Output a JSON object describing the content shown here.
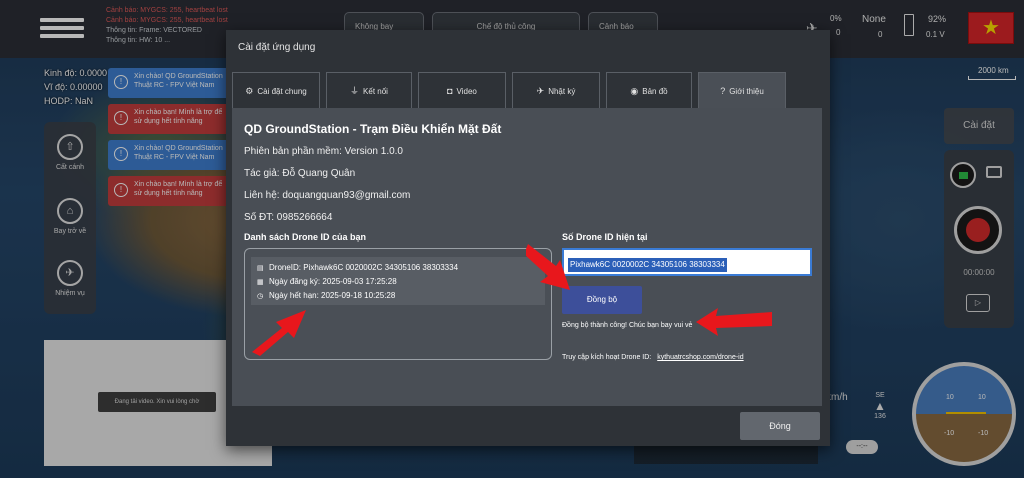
{
  "topbar": {
    "log": [
      "Cảnh báo: MYGCS: 255, heartbeat lost",
      "Cảnh báo: MYGCS: 255, heartbeat lost",
      "Thông tin: Frame: VECTORED",
      "Thông tin: HW: 10 ..."
    ],
    "chip1": "Không bay",
    "chip2": "Chế độ thủ công",
    "chip3": "Cảnh báo",
    "battery_pct": "92%",
    "voltage": "0.1 V",
    "gps_mode": "None",
    "gps_sats": "0",
    "signal_pct": "0%",
    "signal_val": "0"
  },
  "coords": {
    "lon": "Kinh độ: 0.0000",
    "lat": "Vĩ độ: 0.00000",
    "hdop": "HODP: NaN"
  },
  "tools": [
    {
      "label": "Cất cánh",
      "icon": "takeoff-icon"
    },
    {
      "label": "Bay trở về",
      "icon": "return-home-icon"
    },
    {
      "label": "Nhiệm vụ",
      "icon": "mission-icon"
    }
  ],
  "toasts": [
    {
      "text": "Xin chào! QD GroundStation Thuật RC - FPV Việt Nam",
      "kind": "info"
    },
    {
      "text": "Xin chào bạn! Mình là trợ để sử dụng hết tính năng",
      "kind": "warn"
    },
    {
      "text": "Xin chào! QD GroundStation Thuật RC - FPV Việt Nam",
      "kind": "info"
    },
    {
      "text": "Xin chào bạn! Mình là trợ để sử dụng hết tính năng",
      "kind": "warn"
    }
  ],
  "video": {
    "loading": "Đang tải video. Xin vui lòng chờ"
  },
  "map": {
    "scale": "2000 km"
  },
  "right": {
    "settings": "Cài đặt",
    "rec_time": "00:00:00",
    "speed_unit": "km/h",
    "compass_dir": "SE",
    "compass_deg": "136",
    "speed_chip": "--:--",
    "att_marks": [
      "10",
      "10",
      "-10",
      "-10"
    ]
  },
  "dialog": {
    "title": "Cài đặt ứng dụng",
    "tabs": [
      {
        "label": "Cài đặt chung",
        "icon": "gears-icon"
      },
      {
        "label": "Kết nối",
        "icon": "usb-icon"
      },
      {
        "label": "Video",
        "icon": "camera-icon"
      },
      {
        "label": "Nhật ký",
        "icon": "drone-icon"
      },
      {
        "label": "Bản đồ",
        "icon": "globe-icon"
      },
      {
        "label": "Giới thiệu",
        "icon": "question-icon"
      }
    ],
    "about": {
      "app_title": "QD GroundStation - Trạm Điều Khiển Mặt Đất",
      "version": "Phiên bản phần mềm: Version 1.0.0",
      "author": "Tác giả: Đỗ Quang Quân",
      "contact": "Liên hệ: doquangquan93@gmail.com",
      "phone": "Số ĐT: 0985266664"
    },
    "drone_list": {
      "title": "Danh sách Drone ID của bạn",
      "drone_id": "DroneID: Pixhawk6C 0020002C 34305106 38303334",
      "registered": "Ngày đăng ký: 2025-09-03 17:25:28",
      "expires": "Ngày hết hạn: 2025-09-18 10:25:28"
    },
    "current": {
      "title": "Số Drone ID hiện tại",
      "value": "Pixhawk6C 0020002C 34305106 38303334",
      "sync_label": "Đồng bộ",
      "sync_msg": "Đồng bộ thành công! Chúc bạn bay vui vẻ",
      "activate_label": "Truy cập kích hoạt Drone ID:",
      "activate_link": "kythuatrcshop.com/drone-id"
    },
    "close_label": "Đóng"
  },
  "colors": {
    "accent": "#3d4f9a",
    "annotation": "#e8171c",
    "flag": "#d8262a"
  }
}
